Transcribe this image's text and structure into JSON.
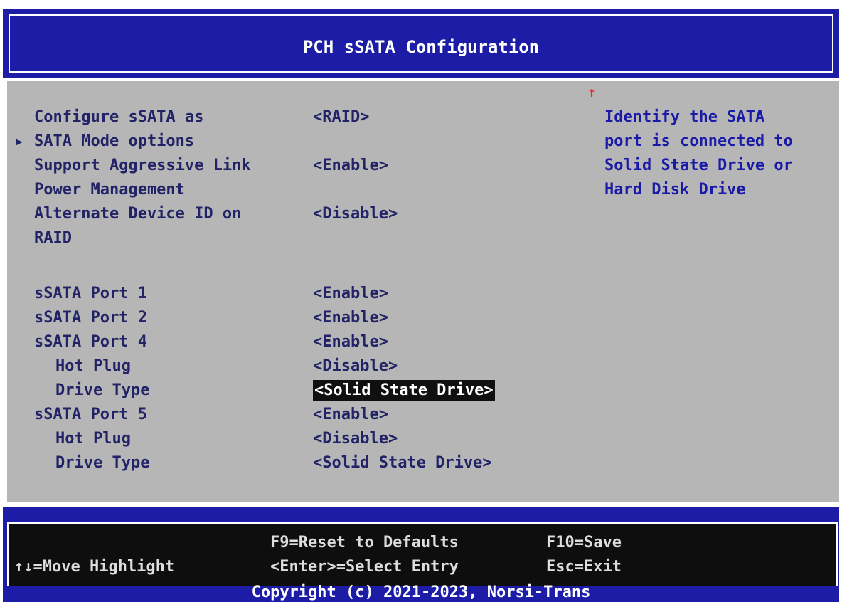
{
  "header": {
    "title": "PCH sSATA Configuration"
  },
  "menu": {
    "items": [
      {
        "label": "Configure sSATA as",
        "value": "<RAID>"
      },
      {
        "label": "SATA Mode options",
        "value": ""
      },
      {
        "label": "Support Aggressive Link",
        "value": "<Enable>"
      },
      {
        "label": "Power Management",
        "value": ""
      },
      {
        "label": "Alternate Device ID on",
        "value": "<Disable>"
      },
      {
        "label": "RAID",
        "value": ""
      },
      {
        "label": "sSATA Port 1",
        "value": "<Enable>"
      },
      {
        "label": "sSATA Port 2",
        "value": "<Enable>"
      },
      {
        "label": "sSATA Port 4",
        "value": "<Enable>"
      },
      {
        "label": "Hot Plug",
        "value": "<Disable>"
      },
      {
        "label": "Drive Type",
        "value": "<Solid State Drive>"
      },
      {
        "label": "sSATA Port 5",
        "value": "<Enable>"
      },
      {
        "label": "Hot Plug",
        "value": "<Disable>"
      },
      {
        "label": "Drive Type",
        "value": "<Solid State Drive>"
      }
    ]
  },
  "help": {
    "lines": [
      "Identify the SATA",
      "port is connected to",
      "Solid State Drive or",
      "Hard Disk Drive"
    ]
  },
  "scroll_indicator": "↑",
  "footer": {
    "reset": "F9=Reset to Defaults",
    "save": "F10=Save",
    "move": "↑↓=Move Highlight",
    "select": "<Enter>=Select Entry",
    "exit": "Esc=Exit",
    "copyright": "Copyright (c) 2021-2023, Norsi-Trans"
  },
  "colors": {
    "header_bg": "#1c1ca6",
    "body_bg": "#b6b6b6",
    "help_text": "#1a1aa8",
    "selected_bg": "#101010"
  }
}
